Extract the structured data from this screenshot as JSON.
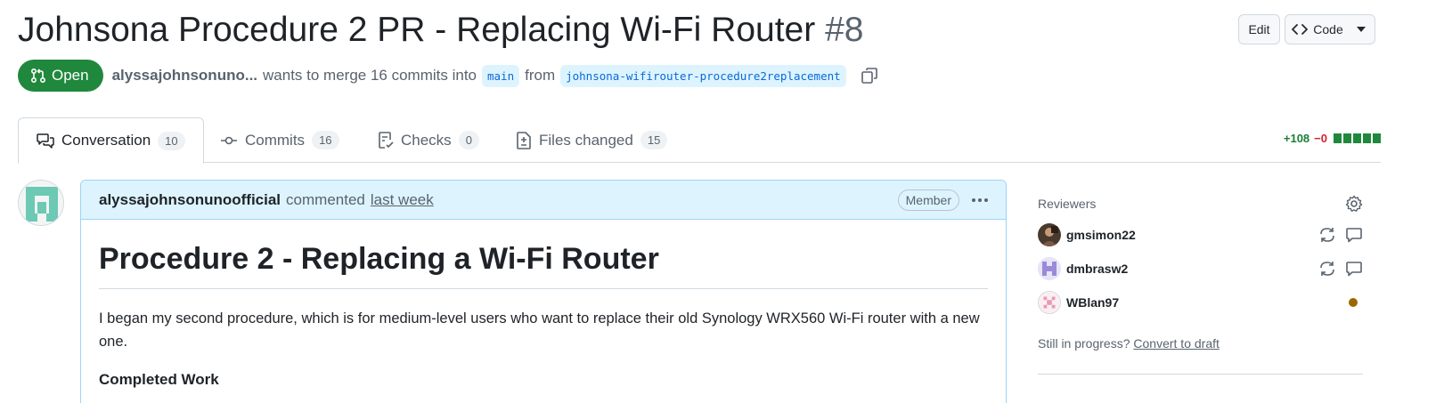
{
  "pr": {
    "title": "Johnsona Procedure 2 PR - Replacing Wi-Fi Router",
    "number": "#8",
    "edit_label": "Edit",
    "code_label": "Code",
    "state": "Open",
    "author": "alyssajohnsonuno...",
    "merge_text": "wants to merge 16 commits into",
    "base_branch": "main",
    "from_text": "from",
    "head_branch": "johnsona-wifirouter-procedure2replacement"
  },
  "tabs": [
    {
      "label": "Conversation",
      "count": "10",
      "icon": "comment-discussion-icon"
    },
    {
      "label": "Commits",
      "count": "16",
      "icon": "git-commit-icon"
    },
    {
      "label": "Checks",
      "count": "0",
      "icon": "checklist-icon"
    },
    {
      "label": "Files changed",
      "count": "15",
      "icon": "file-diff-icon"
    }
  ],
  "diffstat": {
    "additions": "+108",
    "deletions": "−0"
  },
  "comment": {
    "author": "alyssajohnsonunoofficial",
    "action": "commented",
    "time": "last week",
    "role": "Member",
    "heading": "Procedure 2 - Replacing a Wi-Fi Router",
    "paragraph": "I began my second procedure, which is for medium-level users who want to replace their old Synology WRX560 Wi-Fi router with a new one.",
    "subheading": "Completed Work"
  },
  "sidebar": {
    "reviewers_heading": "Reviewers",
    "reviewers": [
      {
        "name": "gmsimon22",
        "status": "commented"
      },
      {
        "name": "dmbrasw2",
        "status": "commented"
      },
      {
        "name": "WBlan97",
        "status": "pending"
      }
    ],
    "draft_question": "Still in progress?",
    "draft_link": "Convert to draft"
  },
  "colors": {
    "open_green": "#1f883d",
    "link_blue": "#0969da",
    "comment_header_bg": "#ddf4ff",
    "pending": "#9a6700"
  }
}
